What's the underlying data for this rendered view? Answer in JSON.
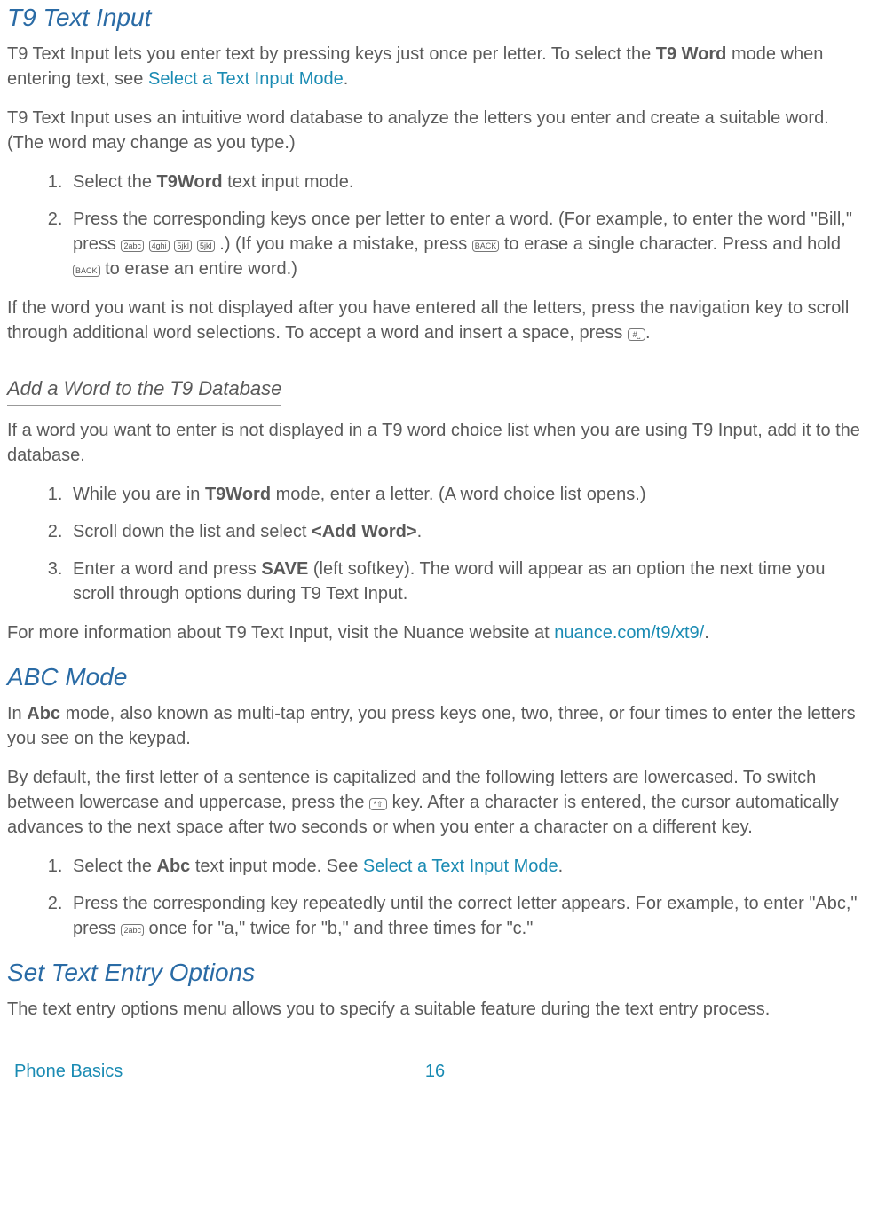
{
  "sections": {
    "t9": {
      "heading": "T9 Text Input",
      "intro_a": "T9 Text Input lets you enter text by pressing keys just once per letter. To select the ",
      "intro_bold": "T9 Word",
      "intro_b": " mode when entering text, see ",
      "intro_link": "Select a Text Input Mode",
      "intro_c": ".",
      "p2": "T9 Text Input uses an intuitive word database to analyze the letters you enter and create a suitable word. (The word may change as you type.)",
      "step1_a": "Select the ",
      "step1_bold": "T9Word",
      "step1_b": " text input mode.",
      "step2_a": "Press the corresponding keys once per letter to enter a word. (For example, to enter the word \"Bill,\" press ",
      "step2_keys": [
        "2abc",
        "4ghi",
        "5jkl",
        "5jkl"
      ],
      "step2_b": ".) (If you make a mistake, press ",
      "step2_back": "BACK",
      "step2_c": " to erase a single character. Press and hold ",
      "step2_back2": "BACK",
      "step2_d": " to erase an entire word.)",
      "p3_a": "If the word you want is not displayed after you have entered all the letters, press the navigation key to scroll through additional word selections. To accept a word and insert a space, press ",
      "p3_key": "#⎵",
      "p3_b": "."
    },
    "add_word": {
      "heading": "Add a Word to the T9 Database",
      "p1": "If a word you want to enter is not displayed in a T9 word choice list when you are using T9 Input, add it to the database.",
      "step1_a": "While you are in ",
      "step1_bold": "T9Word",
      "step1_b": " mode, enter a letter. (A word choice list opens.)",
      "step2_a": "Scroll down the list and select ",
      "step2_bold": "<Add Word>",
      "step2_b": ".",
      "step3_a": "Enter a word and press ",
      "step3_bold": "SAVE",
      "step3_b": " (left softkey). The word will appear as an option the next time you scroll through options during T9 Text Input.",
      "p2_a": "For more information about T9 Text Input, visit the Nuance website at ",
      "p2_link": "nuance.com/t9/xt9/",
      "p2_b": "."
    },
    "abc": {
      "heading": "ABC Mode",
      "p1_a": "In ",
      "p1_bold": "Abc",
      "p1_b": " mode, also known as multi-tap entry, you press keys one, two, three, or four times to enter the letters you see on the keypad.",
      "p2_a": "By default, the first letter of a sentence is capitalized and the following letters are lowercased. To switch between lowercase and uppercase, press the ",
      "p2_key": "*⇧",
      "p2_b": " key. After a character is entered, the cursor automatically advances to the next space after two seconds or when you enter a character on a different key.",
      "step1_a": "Select the ",
      "step1_bold": "Abc",
      "step1_b": " text input mode. See ",
      "step1_link": "Select a Text Input Mode",
      "step1_c": ".",
      "step2_a": "Press the corresponding key repeatedly until the correct letter appears. For example, to enter \"Abc,\" press ",
      "step2_key": "2abc",
      "step2_b": " once for \"a,\" twice for \"b,\" and three times for \"c.\""
    },
    "set_options": {
      "heading": "Set Text Entry Options",
      "p1": "The text entry options menu allows you to specify a suitable feature during the text entry process."
    }
  },
  "footer": {
    "section": "Phone Basics",
    "page": "16"
  }
}
